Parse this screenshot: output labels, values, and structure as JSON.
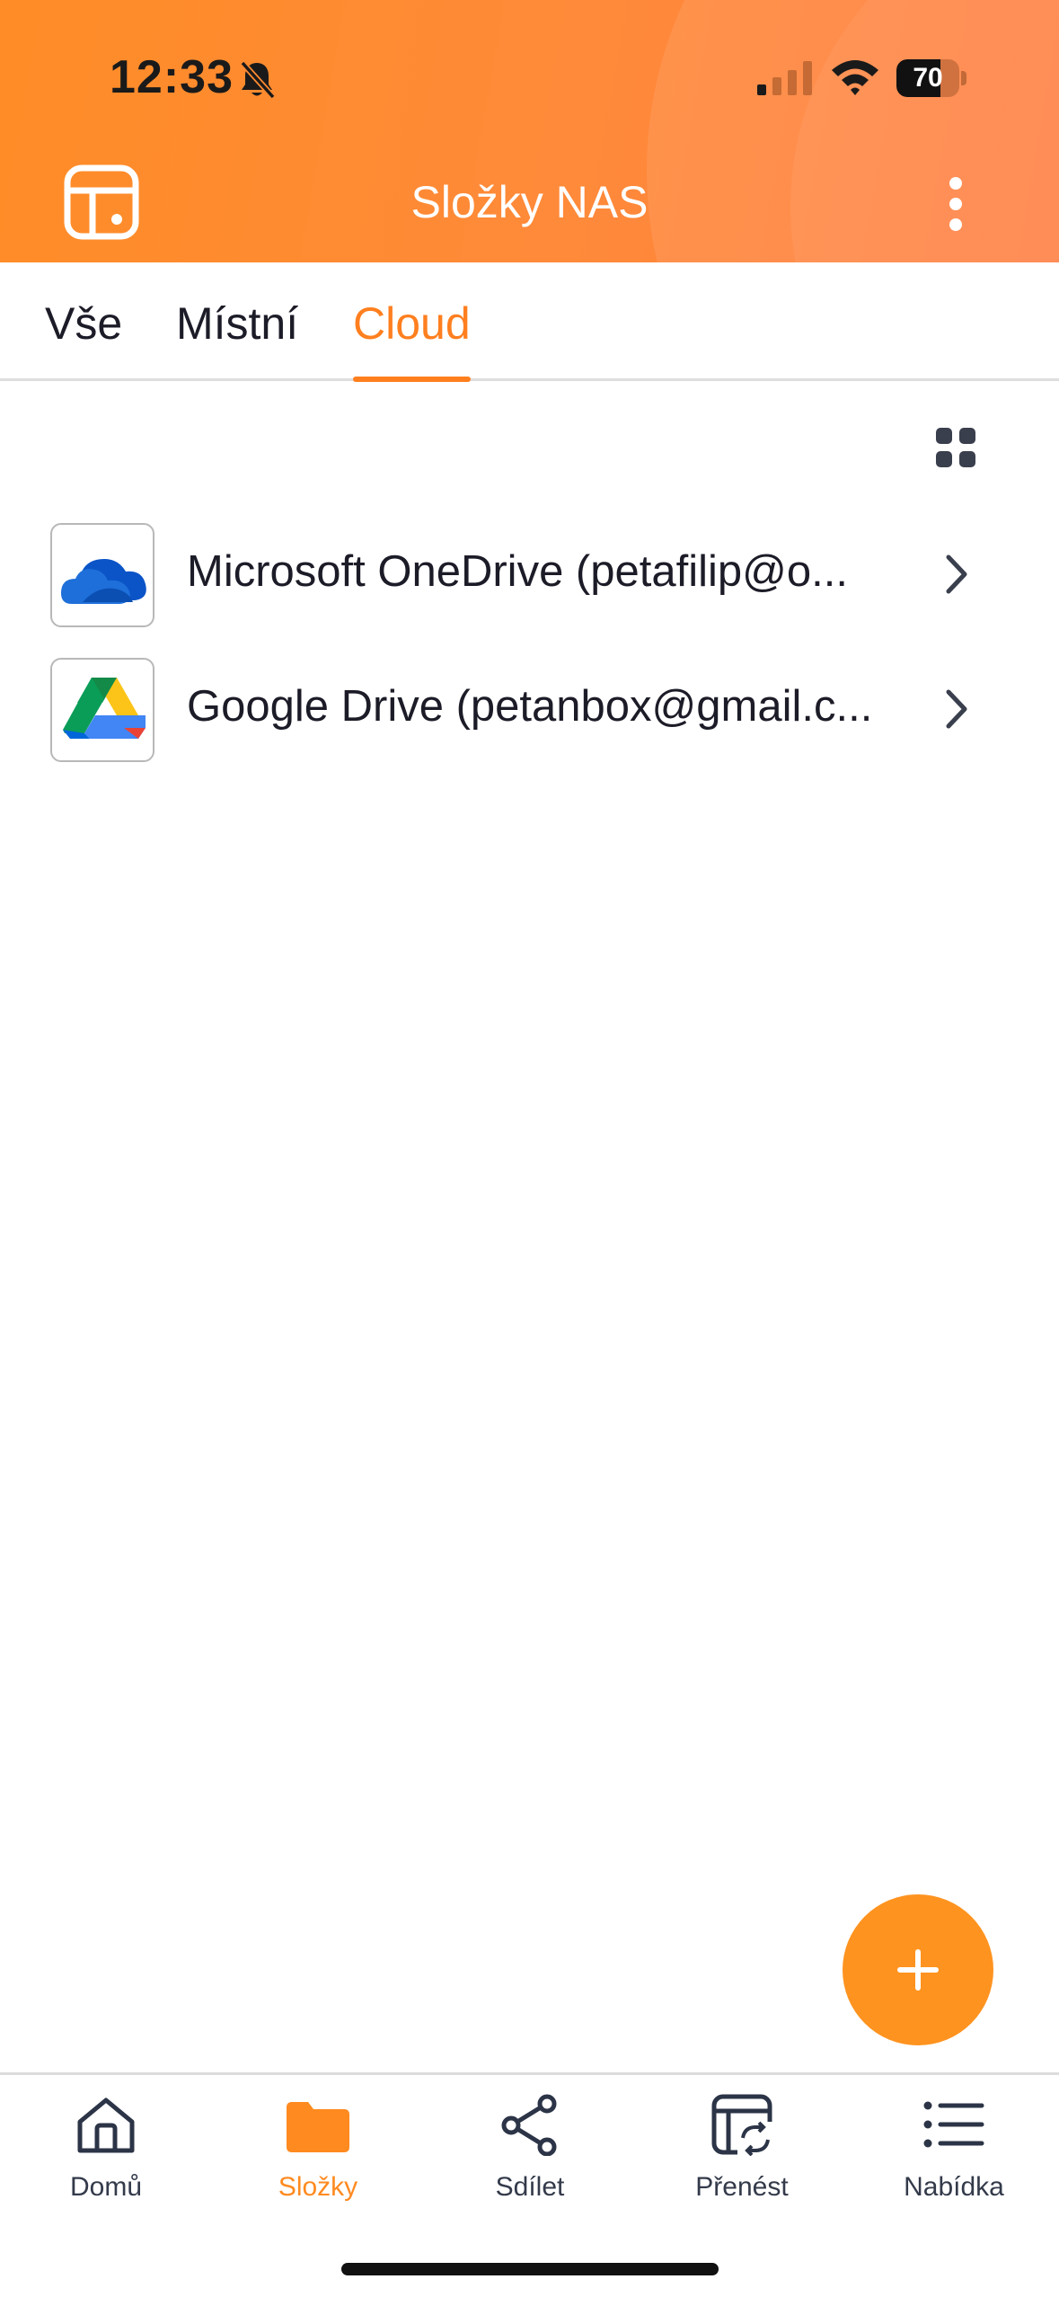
{
  "status_bar": {
    "time": "12:33",
    "battery_level": "70",
    "battery_fraction": 0.7
  },
  "header": {
    "title": "Složky NAS",
    "background_color": "#ff8a2e"
  },
  "tabs": [
    {
      "label": "Vše",
      "active": false
    },
    {
      "label": "Místní",
      "active": false
    },
    {
      "label": "Cloud",
      "active": true
    }
  ],
  "accent_color": "#ff7f1f",
  "cloud_items": [
    {
      "label": "Microsoft OneDrive (petafilip@o...",
      "icon": "onedrive-logo"
    },
    {
      "label": "Google Drive (petanbox@gmail.c...",
      "icon": "google-drive-logo"
    }
  ],
  "bottom_nav": [
    {
      "label": "Domů",
      "icon": "home-icon",
      "active": false
    },
    {
      "label": "Složky",
      "icon": "folder-icon",
      "active": true
    },
    {
      "label": "Sdílet",
      "icon": "share-icon",
      "active": false
    },
    {
      "label": "Přenést",
      "icon": "transfer-icon",
      "active": false
    },
    {
      "label": "Nabídka",
      "icon": "menu-list-icon",
      "active": false
    }
  ]
}
